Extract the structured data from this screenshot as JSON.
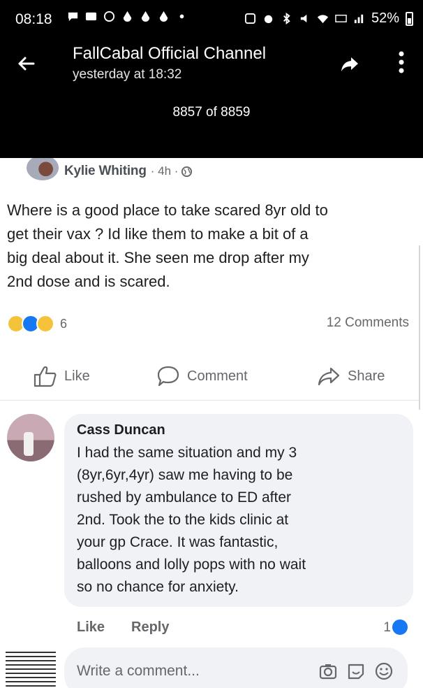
{
  "status_bar": {
    "time": "08:18",
    "battery": "52%"
  },
  "viewer": {
    "title": "FallCabal Official Channel",
    "subtitle": "yesterday at 18:32",
    "counter": "8857 of 8859"
  },
  "post": {
    "author": "Kylie Whiting",
    "meta": "· 4h ·",
    "lines": [
      "Where is a good place to take scared 8yr old to",
      "get their vax ? Id like them to make a bit of a",
      "big deal about it. She seen me drop after my",
      "2nd dose and is scared."
    ],
    "reaction_count": "6",
    "comments_count": "12 Comments",
    "actions": {
      "like": "Like",
      "comment": "Comment",
      "share": "Share"
    }
  },
  "comment": {
    "author": "Cass Duncan",
    "lines": [
      "I had the same situation and my 3",
      "(8yr,6yr,4yr) saw me having to be",
      "rushed by ambulance to ED after",
      "2nd. Took the to the kids clinic at",
      "your gp Crace. It was fantastic,",
      "balloons and lolly pops with no wait",
      "so no chance for anxiety."
    ],
    "like_label": "Like",
    "reply_label": "Reply",
    "reaction_count": "1"
  },
  "composer": {
    "placeholder": "Write a comment..."
  },
  "colors": {
    "facebook_blue": "#1877f2",
    "muted_text": "#65676b",
    "bubble_bg": "#f0f2f5"
  },
  "icons": [
    "back-arrow-icon",
    "forward-share-icon",
    "more-vert-icon",
    "globe-icon",
    "like-thumb-icon",
    "comment-bubble-icon",
    "share-arrow-icon",
    "camera-icon",
    "sticker-icon",
    "emoji-icon"
  ]
}
